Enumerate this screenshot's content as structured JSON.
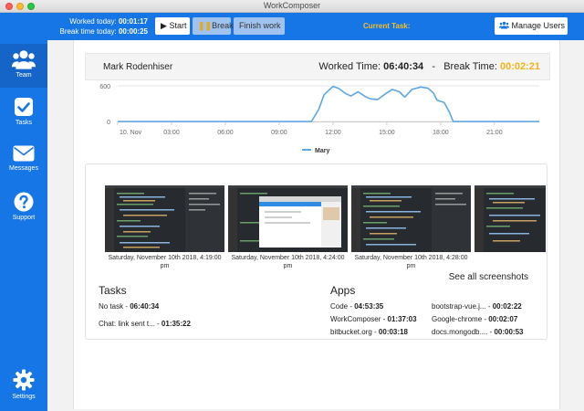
{
  "window": {
    "title": "WorkComposer"
  },
  "toolbar": {
    "worked_today_label": "Worked today:",
    "worked_today_value": "00:01:17",
    "break_today_label": "Break time today:",
    "break_today_value": "00:00:25",
    "start_label": "Start",
    "break_label": "Break",
    "finish_label": "Finish work",
    "current_task_label": "Current Task:",
    "manage_users_label": "Manage Users"
  },
  "sidebar": {
    "items": [
      {
        "label": "Team",
        "icon": "users-icon"
      },
      {
        "label": "Tasks",
        "icon": "checkbox-icon"
      },
      {
        "label": "Messages",
        "icon": "envelope-icon"
      },
      {
        "label": "Support",
        "icon": "question-icon"
      },
      {
        "label": "Settings",
        "icon": "gear-icon"
      }
    ]
  },
  "user": {
    "name": "Mark Rodenhiser",
    "worked_label": "Worked Time:",
    "worked_value": "06:40:34",
    "separator": "-",
    "break_label": "Break Time:",
    "break_value": "00:02:21"
  },
  "chart_data": {
    "type": "area",
    "y_ticks": [
      "600",
      "0"
    ],
    "ylim": [
      0,
      600
    ],
    "x_ticks": [
      "10. Nov",
      "03:00",
      "06:00",
      "09:00",
      "12:00",
      "15:00",
      "18:00",
      "21:00"
    ],
    "x_tick_hours": [
      0,
      3,
      6,
      9,
      12,
      15,
      18,
      21
    ],
    "xlim": [
      0,
      23.5
    ],
    "series": [
      {
        "name": "Mary",
        "color": "#5aa7e8",
        "x": [
          0,
          10.8,
          11.2,
          11.5,
          12.0,
          12.3,
          12.7,
          13.0,
          13.4,
          13.8,
          14.1,
          14.5,
          14.9,
          15.3,
          15.7,
          16.0,
          16.4,
          16.9,
          17.3,
          17.6,
          17.8,
          18.2,
          18.5,
          18.7,
          19.0,
          23.5
        ],
        "values": [
          0,
          0,
          200,
          450,
          590,
          560,
          470,
          430,
          500,
          420,
          380,
          370,
          460,
          540,
          500,
          410,
          540,
          580,
          560,
          480,
          360,
          320,
          150,
          0,
          0,
          0
        ]
      }
    ]
  },
  "screenshots": [
    {
      "caption": "Saturday, November 10th 2018, 4:19:00 pm"
    },
    {
      "caption": "Saturday, November 10th 2018, 4:24:00 pm"
    },
    {
      "caption": "Saturday, November 10th 2018, 4:28:00 pm"
    }
  ],
  "see_all_label": "See all screenshots",
  "tasks": {
    "title": "Tasks",
    "items": [
      {
        "name": "No task",
        "time": "06:40:34"
      },
      {
        "name": "Chat: link sent t...",
        "time": "01:35:22"
      }
    ]
  },
  "apps": {
    "title": "Apps",
    "items": [
      {
        "name": "Code",
        "time": "04:53:35"
      },
      {
        "name": "WorkComposer",
        "time": "01:37:03"
      },
      {
        "name": "bitbucket.org",
        "time": "00:03:18"
      },
      {
        "name": "bootstrap-vue.j...",
        "time": "00:02:22"
      },
      {
        "name": "Google-chrome",
        "time": "00:02:07"
      },
      {
        "name": "docs.mongodb....",
        "time": "00:00:53"
      }
    ]
  },
  "colors": {
    "brand_blue": "#1676e6",
    "break_yellow": "#f2b319",
    "series_blue": "#5aa7e8"
  }
}
